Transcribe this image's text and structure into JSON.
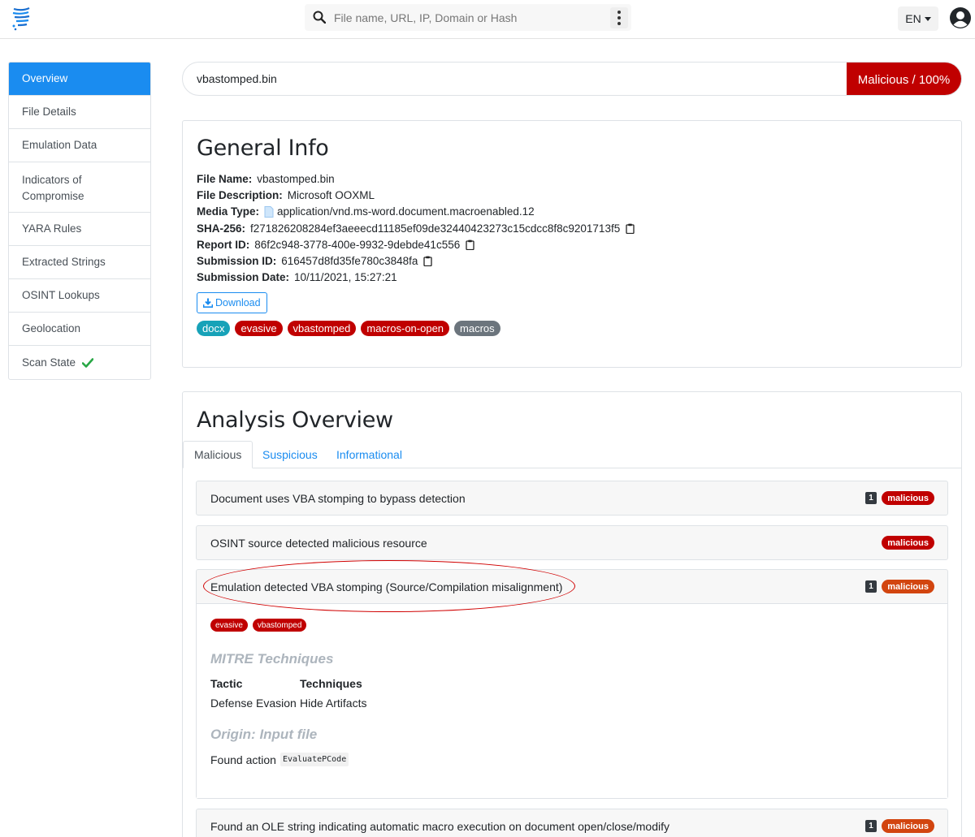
{
  "header": {
    "search_placeholder": "File name, URL, IP, Domain or Hash",
    "language": "EN"
  },
  "sidebar": {
    "items": [
      {
        "label": "Overview",
        "active": true
      },
      {
        "label": "File Details"
      },
      {
        "label": "Emulation Data"
      },
      {
        "label": "Indicators of Compromise"
      },
      {
        "label": "YARA Rules"
      },
      {
        "label": "Extracted Strings"
      },
      {
        "label": "OSINT Lookups"
      },
      {
        "label": "Geolocation"
      },
      {
        "label": "Scan State",
        "status_icon": "check-icon"
      }
    ]
  },
  "file_bar": {
    "filename": "vbastomped.bin",
    "verdict": "Malicious / 100%",
    "verdict_color": "#c00000"
  },
  "general_info": {
    "title": "General Info",
    "rows": [
      {
        "key": "File Name:",
        "value": "vbastomped.bin"
      },
      {
        "key": "File Description:",
        "value": "Microsoft OOXML"
      },
      {
        "key": "Media Type:",
        "value": "application/vnd.ms-word.document.macroenabled.12"
      },
      {
        "key": "SHA-256:",
        "value": "f271826208284ef3aeeecd11185ef09de32440423273c15cdcc8f8c9201713f5"
      },
      {
        "key": "Report ID:",
        "value": "86f2c948-3778-400e-9932-9debde41c556"
      },
      {
        "key": "Submission ID:",
        "value": "616457d8fd35fe780c3848fa"
      },
      {
        "key": "Submission Date:",
        "value": "10/11/2021, 15:27:21"
      }
    ],
    "download_label": "Download",
    "tags": [
      {
        "label": "docx",
        "color": "#17a2b8"
      },
      {
        "label": "evasive",
        "color": "#c00000"
      },
      {
        "label": "vbastomped",
        "color": "#c00000"
      },
      {
        "label": "macros-on-open",
        "color": "#c00000"
      },
      {
        "label": "macros",
        "color": "#6c757d"
      }
    ]
  },
  "analysis": {
    "title": "Analysis Overview",
    "tabs": [
      "Malicious",
      "Suspicious",
      "Informational"
    ],
    "signals": [
      {
        "title": "Document uses VBA stomping to bypass detection",
        "count": "1",
        "badge": "malicious"
      },
      {
        "title": "OSINT source detected malicious resource",
        "count": "",
        "badge": "malicious"
      },
      {
        "title": "Emulation detected VBA stomping (Source/Compilation misalignment)",
        "count": "1",
        "badge": "malicious"
      },
      {
        "title": "Found an OLE string indicating automatic macro execution on document open/close/modify",
        "count": "1",
        "badge": "malicious"
      }
    ],
    "expanded": {
      "tags": [
        "evasive",
        "vbastomped"
      ],
      "mitre_heading": "MITRE Techniques",
      "tactic_header": "Tactic",
      "techniques_header": "Techniques",
      "tactic": "Defense Evasion",
      "technique": "Hide Artifacts",
      "origin_heading": "Origin: Input file",
      "found_label": "Found action",
      "found_code": "EvaluatePCode"
    }
  }
}
